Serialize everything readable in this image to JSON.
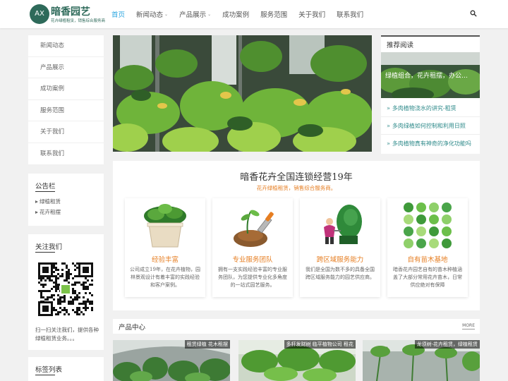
{
  "brand": {
    "badge": "AX",
    "title": "暗香园艺",
    "subtitle": "花卉绿植租赁，销售综合服务商"
  },
  "nav": [
    {
      "label": "首页",
      "active": true,
      "dropdown": false
    },
    {
      "label": "新闻动态",
      "active": false,
      "dropdown": true
    },
    {
      "label": "产品展示",
      "active": false,
      "dropdown": true
    },
    {
      "label": "成功案例",
      "active": false,
      "dropdown": false
    },
    {
      "label": "服务范围",
      "active": false,
      "dropdown": false
    },
    {
      "label": "关于我们",
      "active": false,
      "dropdown": false
    },
    {
      "label": "联系我们",
      "active": false,
      "dropdown": false
    }
  ],
  "sidebar_menu": [
    "新闻动态",
    "产品展示",
    "成功案例",
    "服务范围",
    "关于我们",
    "联系我们"
  ],
  "notice": {
    "title": "公告栏",
    "items": [
      "绿植租赁",
      "花卉租摆"
    ]
  },
  "follow": {
    "title": "关注我们",
    "text": "扫一扫关注我们，提供各种绿植租赁业务。。。"
  },
  "tags_title": "标签列表",
  "recommended": {
    "title": "推荐阅读",
    "thumb_caption": "绿植组合，花卉租摆，办公…",
    "items": [
      "多肉植物浇水的讲究-租赁",
      "多肉绿植如何控制和利用日照",
      "多肉植物真有神奇的净化功能吗"
    ]
  },
  "features": {
    "title": "暗香花卉全国连锁经营19年",
    "subtitle": "花卉绿植租赁，销售综合服务商。",
    "cards": [
      {
        "title": "经验丰富",
        "desc": "公司成立19年，在花卉植物，园林景观设计有着丰富的实践经验和客户案例。"
      },
      {
        "title": "专业服务团队",
        "desc": "拥有一支实践经验丰富的专业服务团队，为您提供专业化多角度的一站式园艺服务。"
      },
      {
        "title": "跨区域服务能力",
        "desc": "我们是全国为数不多的具备全国跨区域服务能力的园艺供应商。"
      },
      {
        "title": "自有苗木基地",
        "desc": "暗香花卉园艺自有的苗木种植涵盖了大部分常用花卉苗木，日常供应绝对有保障"
      }
    ]
  },
  "products": {
    "title": "产品中心",
    "more": "MORE",
    "items": [
      {
        "caption": "租赁绿植 花木租摆"
      },
      {
        "caption": "多杆发财树 临平植物公司 租花"
      },
      {
        "caption": "龙须树-花卉租赁，绿植租赁"
      }
    ]
  },
  "colors": {
    "brand": "#2e6a5a",
    "nav_active": "#2ea7e0",
    "accent_orange": "#e67e22",
    "link_teal": "#2e8a8a"
  },
  "icons": {
    "search": "search-icon",
    "notice_bullet": "triangle-right-icon",
    "dropdown": "chevron-down-icon"
  }
}
